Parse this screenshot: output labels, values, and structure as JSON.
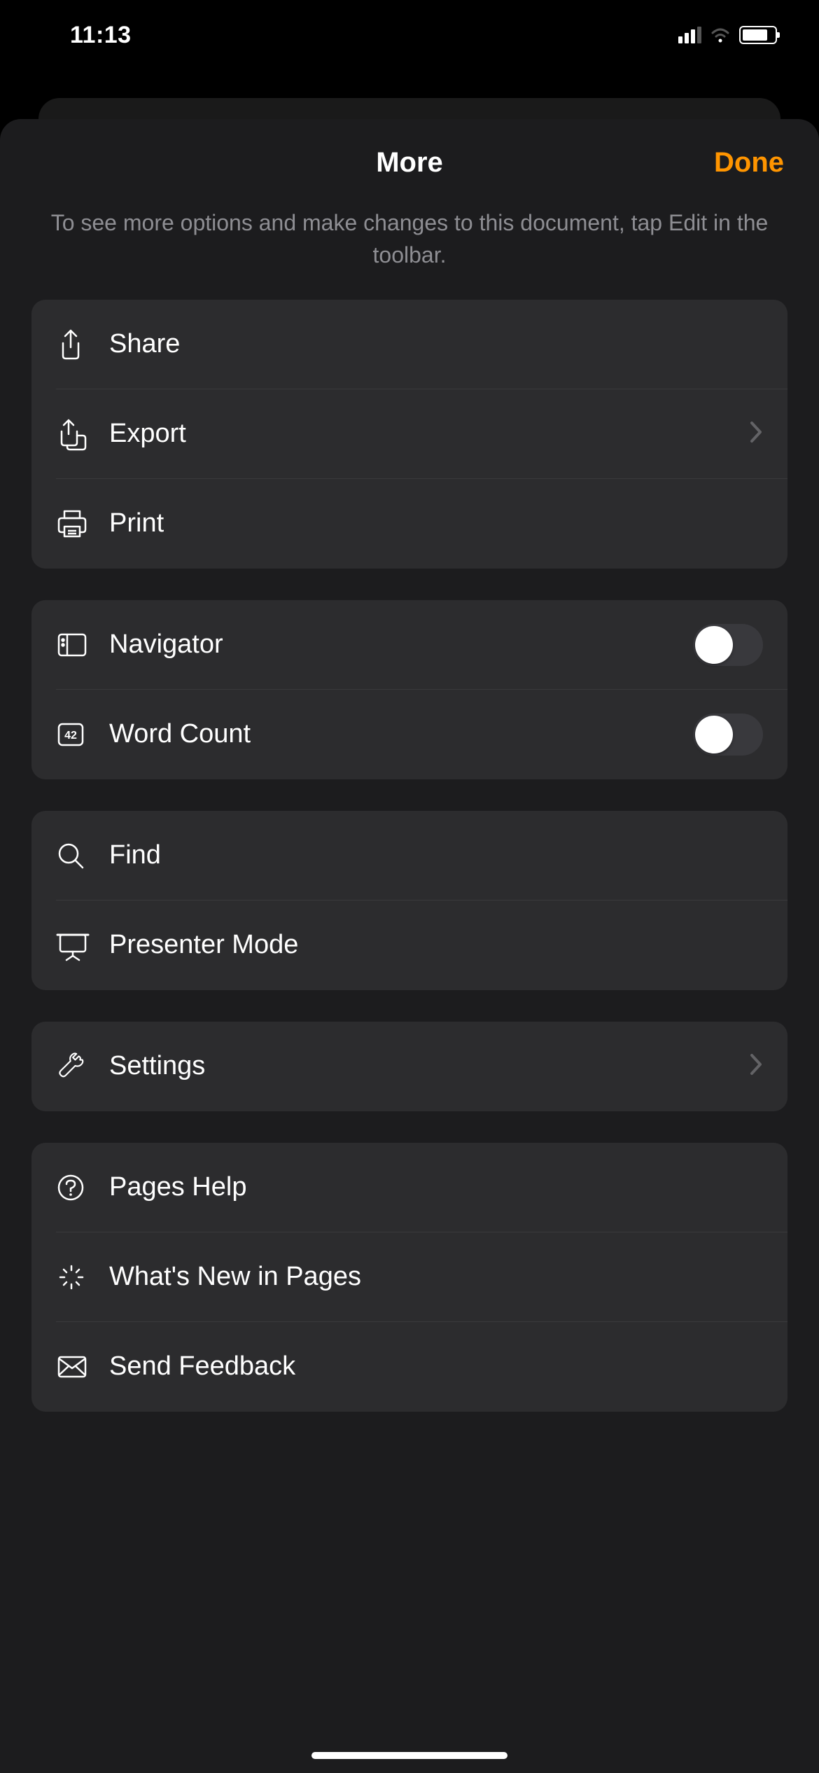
{
  "statusBar": {
    "time": "11:13"
  },
  "sheet": {
    "title": "More",
    "doneLabel": "Done",
    "subtitle": "To see more options and make changes to this document, tap Edit in the toolbar."
  },
  "groups": {
    "share": {
      "share": "Share",
      "export": "Export",
      "print": "Print"
    },
    "view": {
      "navigator": "Navigator",
      "wordCount": "Word Count",
      "navigatorOn": false,
      "wordCountOn": false
    },
    "tools": {
      "find": "Find",
      "presenter": "Presenter Mode"
    },
    "settings": {
      "settings": "Settings"
    },
    "help": {
      "pagesHelp": "Pages Help",
      "whatsNew": "What's New in Pages",
      "feedback": "Send Feedback"
    }
  }
}
